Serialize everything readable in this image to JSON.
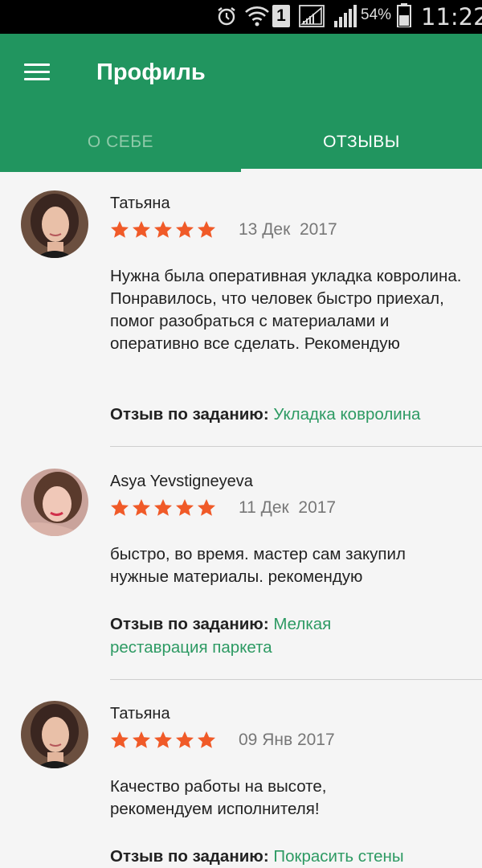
{
  "status_bar": {
    "battery": "54%",
    "time": "11:22",
    "sim_slot": "1",
    "icons": [
      "alarm-icon",
      "wifi-icon",
      "sim-slot-icon",
      "signal-empty-icon",
      "signal-icon",
      "battery-icon"
    ]
  },
  "header": {
    "title": "Профиль",
    "menu_icon": "hamburger-menu-icon"
  },
  "tabs": [
    {
      "label": "О СЕБЕ",
      "selected": false
    },
    {
      "label": "ОТЗЫВЫ",
      "selected": true
    }
  ],
  "colors": {
    "app_bar": "#21955f",
    "star": "#f05a28",
    "link": "#2d9a63"
  },
  "reviews": [
    {
      "author": "Татьяна",
      "rating": 5,
      "date": "13 Дек  2017",
      "text": "Нужна была оперативная укладка ковролина. Понравилось, что человек быстро приехал, помог разобраться с материалами и оперативно все сделать. Рекомендую",
      "task_label": "Отзыв по заданию",
      "task": "Укладка ковролина"
    },
    {
      "author": "Asya Yevstigneyeva",
      "rating": 5,
      "date": "11 Дек  2017",
      "text": "быстро, во время. мастер сам закупил нужные материалы. рекомендую",
      "task_label": "Отзыв по заданию",
      "task": "Мелкая реставрация паркета"
    },
    {
      "author": "Татьяна",
      "rating": 5,
      "date": "09 Янв 2017",
      "text": "Качество работы на высоте, рекомендуем исполнителя!",
      "task_label": "Отзыв по заданию",
      "task": "Покрасить стены"
    }
  ]
}
